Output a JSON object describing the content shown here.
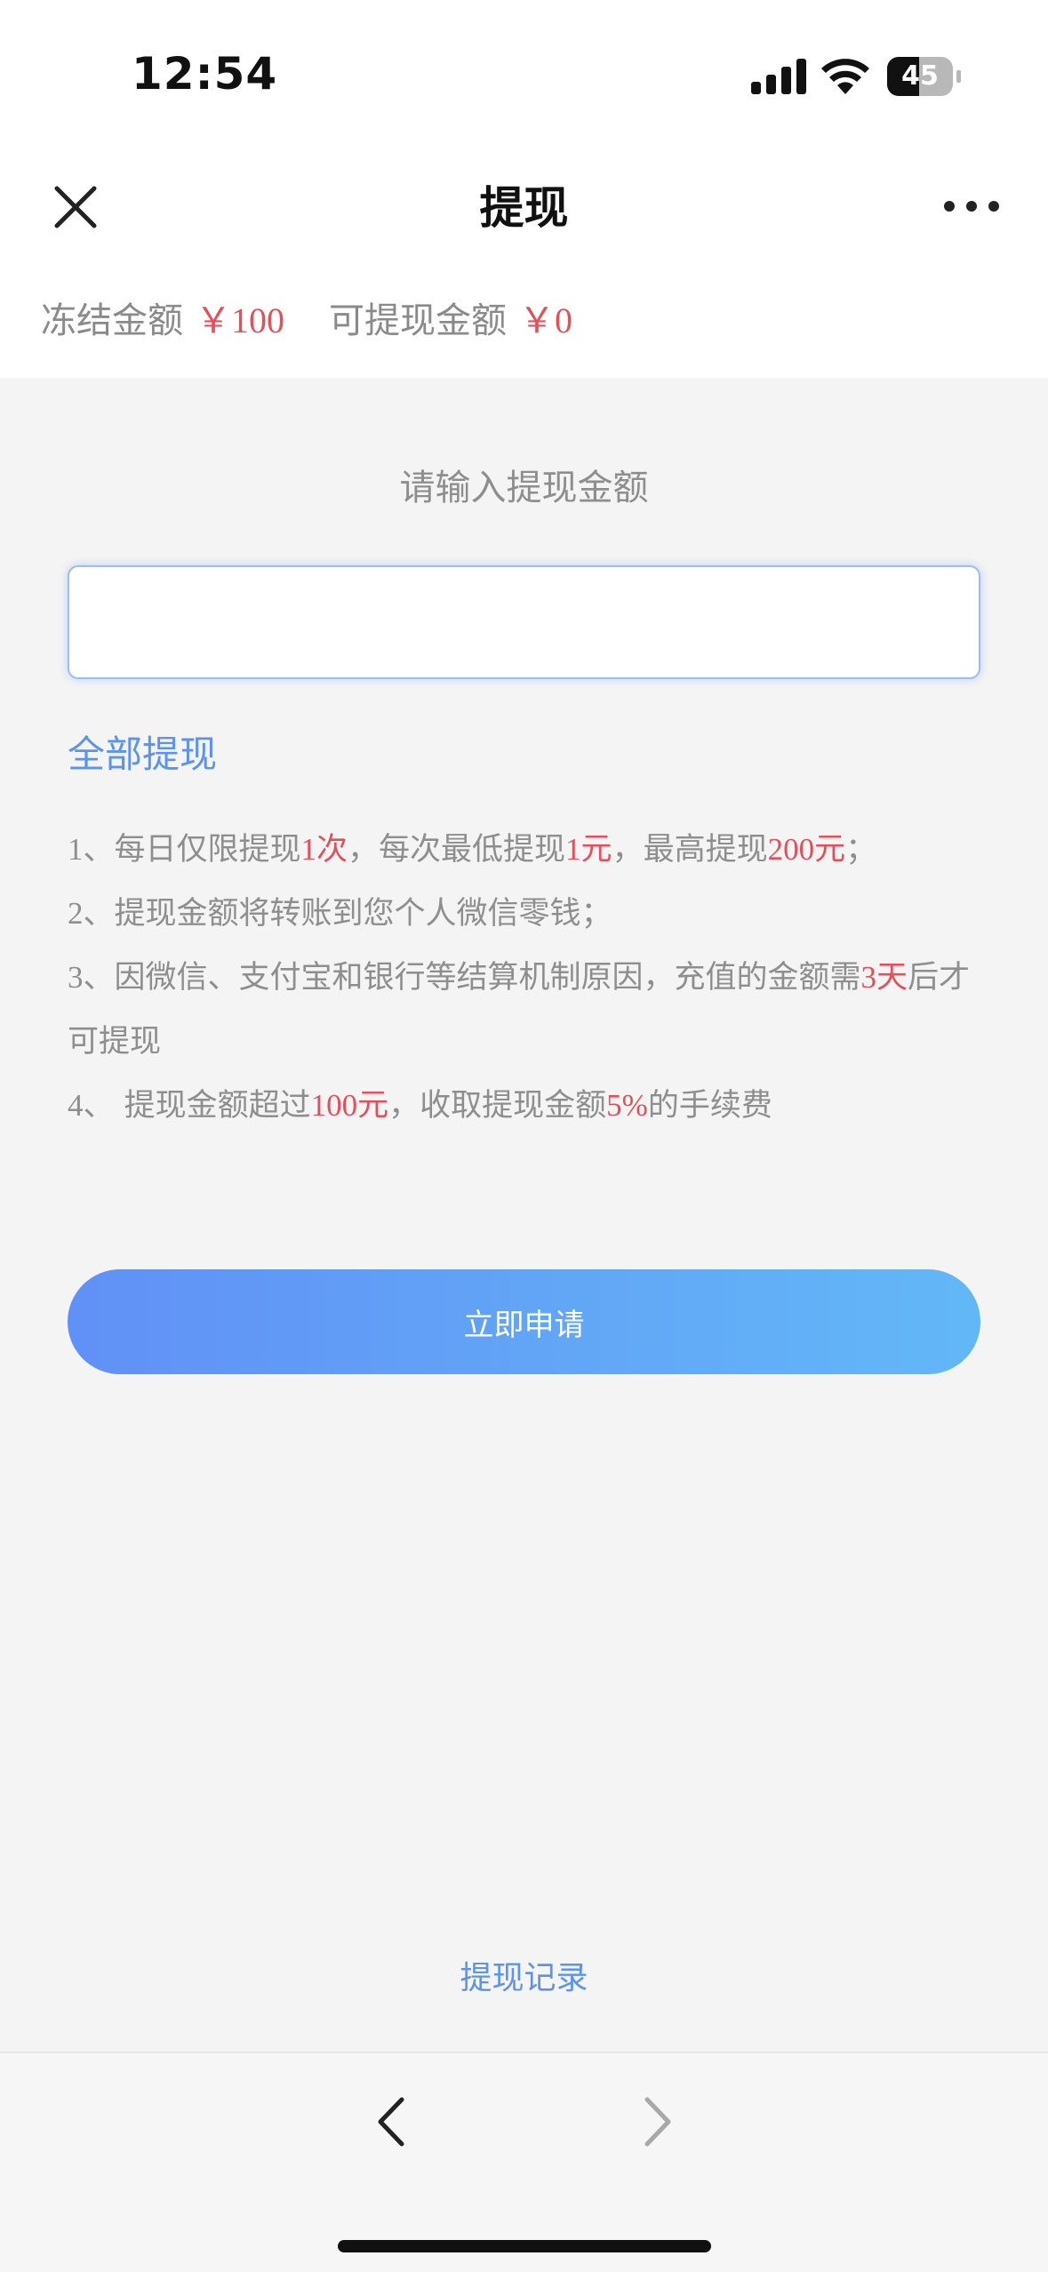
{
  "status_bar": {
    "time": "12:54",
    "battery": "45",
    "icons": [
      "signal-icon",
      "wifi-icon",
      "battery-icon"
    ]
  },
  "nav": {
    "title": "提现",
    "close_icon": "close-icon",
    "more_icon": "more-icon"
  },
  "balance": {
    "frozen_label": "冻结金额",
    "frozen_amount": "￥100",
    "available_label": "可提现金额",
    "available_amount": "￥0"
  },
  "form": {
    "prompt": "请输入提现金额",
    "input_value": "",
    "withdraw_all": "全部提现",
    "apply_button": "立即申请"
  },
  "rules": [
    [
      {
        "t": "1",
        "c": "num"
      },
      {
        "t": "、每日仅限提现",
        "c": ""
      },
      {
        "t": "1",
        "c": "hl num"
      },
      {
        "t": "次",
        "c": "hl"
      },
      {
        "t": "，每次最低提现",
        "c": ""
      },
      {
        "t": "1",
        "c": "hl num"
      },
      {
        "t": "元",
        "c": "hl"
      },
      {
        "t": "，最高提现",
        "c": ""
      },
      {
        "t": "200",
        "c": "hl num"
      },
      {
        "t": "元",
        "c": "hl"
      },
      {
        "t": "；",
        "c": ""
      }
    ],
    [
      {
        "t": "2",
        "c": "num"
      },
      {
        "t": "、提现金额将转账到您个人微信零钱；",
        "c": ""
      }
    ],
    [
      {
        "t": "3",
        "c": "num"
      },
      {
        "t": "、因微信、支付宝和银行等结算机制原因，充值的金额需",
        "c": ""
      },
      {
        "t": "3",
        "c": "hl num"
      },
      {
        "t": "天",
        "c": "hl"
      },
      {
        "t": "后才可提现",
        "c": ""
      }
    ],
    [
      {
        "t": "4",
        "c": "num"
      },
      {
        "t": "、 提现金额超过",
        "c": ""
      },
      {
        "t": "100",
        "c": "hl num"
      },
      {
        "t": "元",
        "c": "hl"
      },
      {
        "t": "，收取提现金额",
        "c": ""
      },
      {
        "t": "5%",
        "c": "hl num"
      },
      {
        "t": "的手续费",
        "c": ""
      }
    ]
  ],
  "footer": {
    "records_link": "提现记录",
    "back_icon": "chevron-left-icon",
    "forward_icon": "chevron-right-icon"
  },
  "colors": {
    "accent_blue": "#5b93ee",
    "highlight_red": "#e4505a",
    "button_gradient_start": "#6190f6",
    "button_gradient_end": "#62b8f7",
    "background": "#f4f4f5"
  }
}
